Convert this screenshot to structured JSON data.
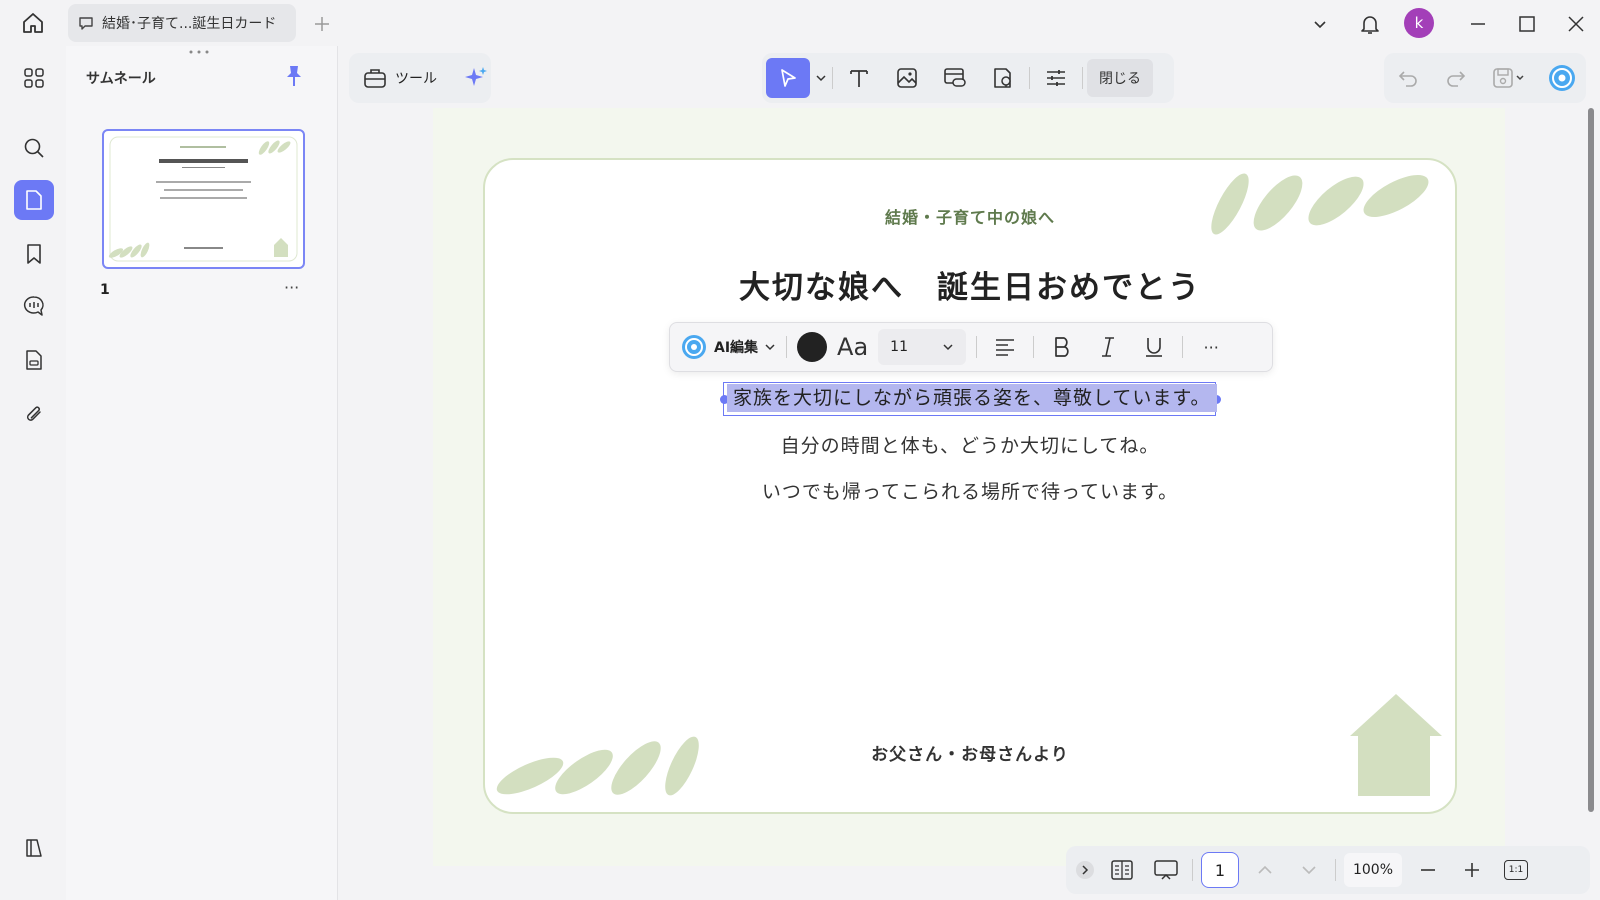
{
  "tabs": {
    "document_title": "結婚･子育て...誕生日カード",
    "avatar_initial": "k"
  },
  "sidebar": {
    "thumbnail_title": "サムネール",
    "page_number": "1",
    "more": "···"
  },
  "toolbar": {
    "tools_label": "ツール",
    "close_label": "閉じる"
  },
  "format_bar": {
    "ai_edit_label": "AI編集",
    "font_size": "11",
    "more": "···"
  },
  "card": {
    "subtitle": "結婚・子育て中の娘へ",
    "title": "大切な娘へ　誕生日おめでとう",
    "line1": "家族を大切にしながら頑張る姿を、尊敬しています。",
    "line2": "自分の時間と体も、どうか大切にしてね。",
    "line3": "いつでも帰ってこられる場所で待っています。",
    "signature": "お父さん・お母さんより"
  },
  "bottom_bar": {
    "page_input": "1",
    "zoom": "100%",
    "actual_size": "1:1"
  },
  "colors": {
    "accent": "#6c79f5",
    "leaf_green": "#d3dfc0",
    "selection": "#b4b7ef",
    "avatar": "#a33fb8"
  }
}
